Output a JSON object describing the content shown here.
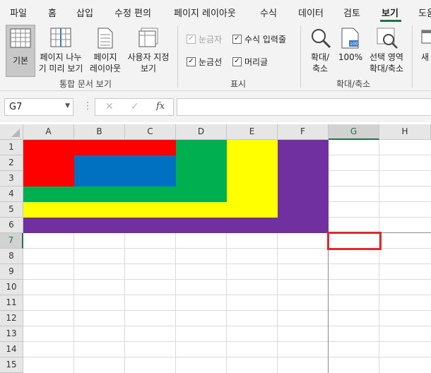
{
  "tabs": [
    {
      "label": "파일"
    },
    {
      "label": "홈"
    },
    {
      "label": "삽입"
    },
    {
      "label": "수정 편의"
    },
    {
      "label": "페이지 레이아웃"
    },
    {
      "label": "수식"
    },
    {
      "label": "데이터"
    },
    {
      "label": "검토"
    },
    {
      "label": "보기"
    },
    {
      "label": "도움"
    }
  ],
  "ribbon": {
    "views": {
      "normal": "기본",
      "pagebreak_line1": "페이지 나누",
      "pagebreak_line2": "기 미리 보기",
      "pagelayout_line1": "페이지",
      "pagelayout_line2": "레이아웃",
      "custom_line1": "사용자 지정",
      "custom_line2": "보기",
      "group": "통합 문서 보기"
    },
    "show": {
      "ruler": "눈금자",
      "formula_bar": "수식 입력줄",
      "gridlines": "눈금선",
      "headings": "머리글",
      "group": "표시"
    },
    "zoom": {
      "zoom_line1": "확대/",
      "zoom_line2": "축소",
      "hundred": "100%",
      "selection_line1": "선택 영역",
      "selection_line2": "확대/축소",
      "group": "확대/축소"
    },
    "new_window": "새"
  },
  "formula_bar": {
    "name_box": "G7",
    "fx": "fx",
    "value": ""
  },
  "columns": [
    "A",
    "B",
    "C",
    "D",
    "E",
    "F",
    "G",
    "H"
  ],
  "rows": [
    "1",
    "2",
    "3",
    "4",
    "5",
    "6",
    "7",
    "8",
    "9",
    "10",
    "11",
    "12",
    "13",
    "14",
    "15"
  ],
  "selected_cell": "G7",
  "colors": {
    "red": "#ff0000",
    "blue": "#0070c0",
    "green": "#00b050",
    "yellow": "#ffff00",
    "purple": "#7030a0",
    "selection_outline": "#e0282e",
    "excel_green": "#217346"
  }
}
